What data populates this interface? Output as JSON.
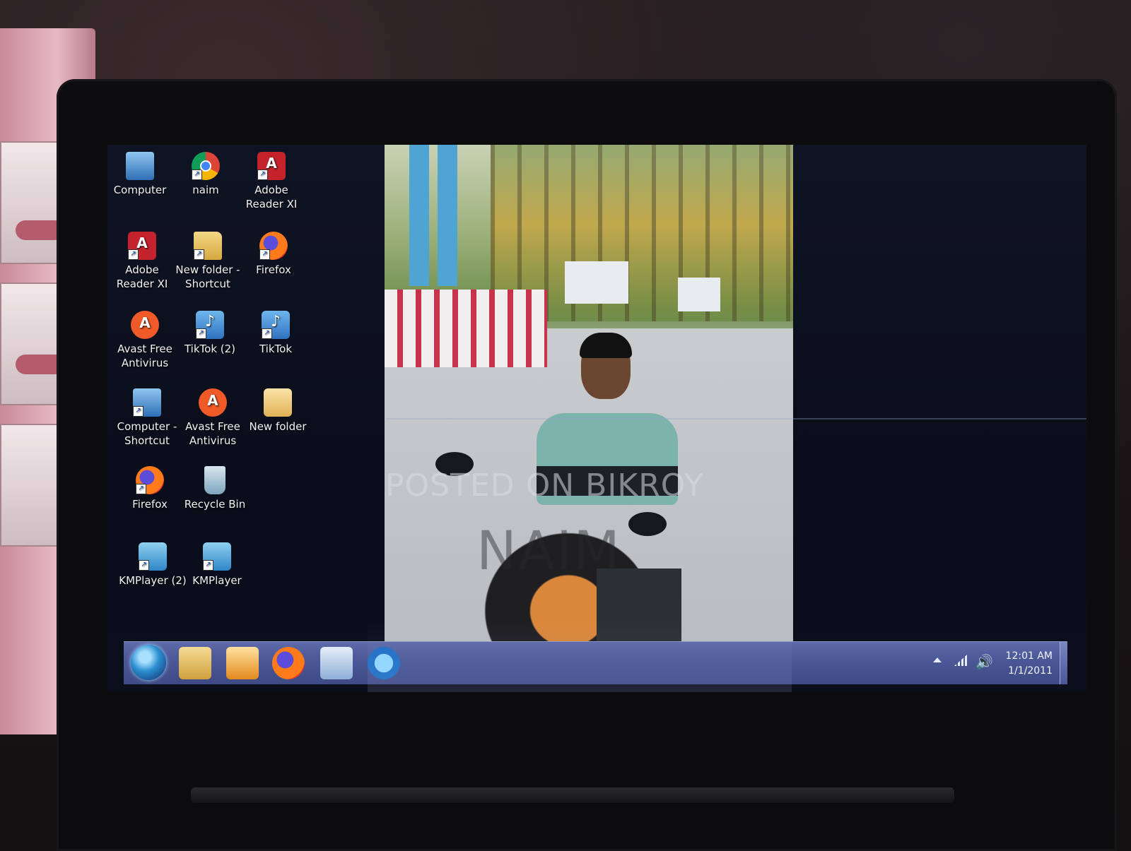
{
  "desktop": {
    "icons": [
      {
        "label_1": "Computer",
        "label_2": "",
        "icon": "computer-icon"
      },
      {
        "label_1": "naim",
        "label_2": "",
        "icon": "chrome-shortcut-icon"
      },
      {
        "label_1": "Adobe",
        "label_2": "Reader XI",
        "icon": "adobe-reader-icon"
      },
      {
        "label_1": "Adobe",
        "label_2": "Reader XI",
        "icon": "adobe-reader-icon"
      },
      {
        "label_1": "New folder -",
        "label_2": "Shortcut",
        "icon": "folder-shortcut-icon"
      },
      {
        "label_1": "Firefox",
        "label_2": "",
        "icon": "firefox-icon"
      },
      {
        "label_1": "Avast Free",
        "label_2": "Antivirus",
        "icon": "avast-icon"
      },
      {
        "label_1": "TikTok (2)",
        "label_2": "",
        "icon": "tiktok-shortcut-icon"
      },
      {
        "label_1": "TikTok",
        "label_2": "",
        "icon": "tiktok-shortcut-icon"
      },
      {
        "label_1": "Computer -",
        "label_2": "Shortcut",
        "icon": "computer-shortcut-icon"
      },
      {
        "label_1": "Avast Free",
        "label_2": "Antivirus",
        "icon": "avast-icon"
      },
      {
        "label_1": "New folder",
        "label_2": "",
        "icon": "chrome-folder-icon"
      },
      {
        "label_1": "Firefox",
        "label_2": "",
        "icon": "firefox-icon"
      },
      {
        "label_1": "Recycle Bin",
        "label_2": "",
        "icon": "recycle-bin-icon"
      },
      {
        "label_1": "KMPlayer (2)",
        "label_2": "",
        "icon": "kmplayer-icon"
      },
      {
        "label_1": "KMPlayer",
        "label_2": "",
        "icon": "kmplayer-icon"
      }
    ]
  },
  "watermark": {
    "line1": "POSTED ON BIKROY",
    "line2": "NAIM"
  },
  "taskbar": {
    "pinned": [
      "start-orb-icon",
      "windows-explorer-icon",
      "media-player-icon",
      "firefox-icon",
      "word-document-icon",
      "internet-explorer-icon"
    ],
    "tray": {
      "time": "12:01 AM",
      "date": "1/1/2011"
    }
  }
}
